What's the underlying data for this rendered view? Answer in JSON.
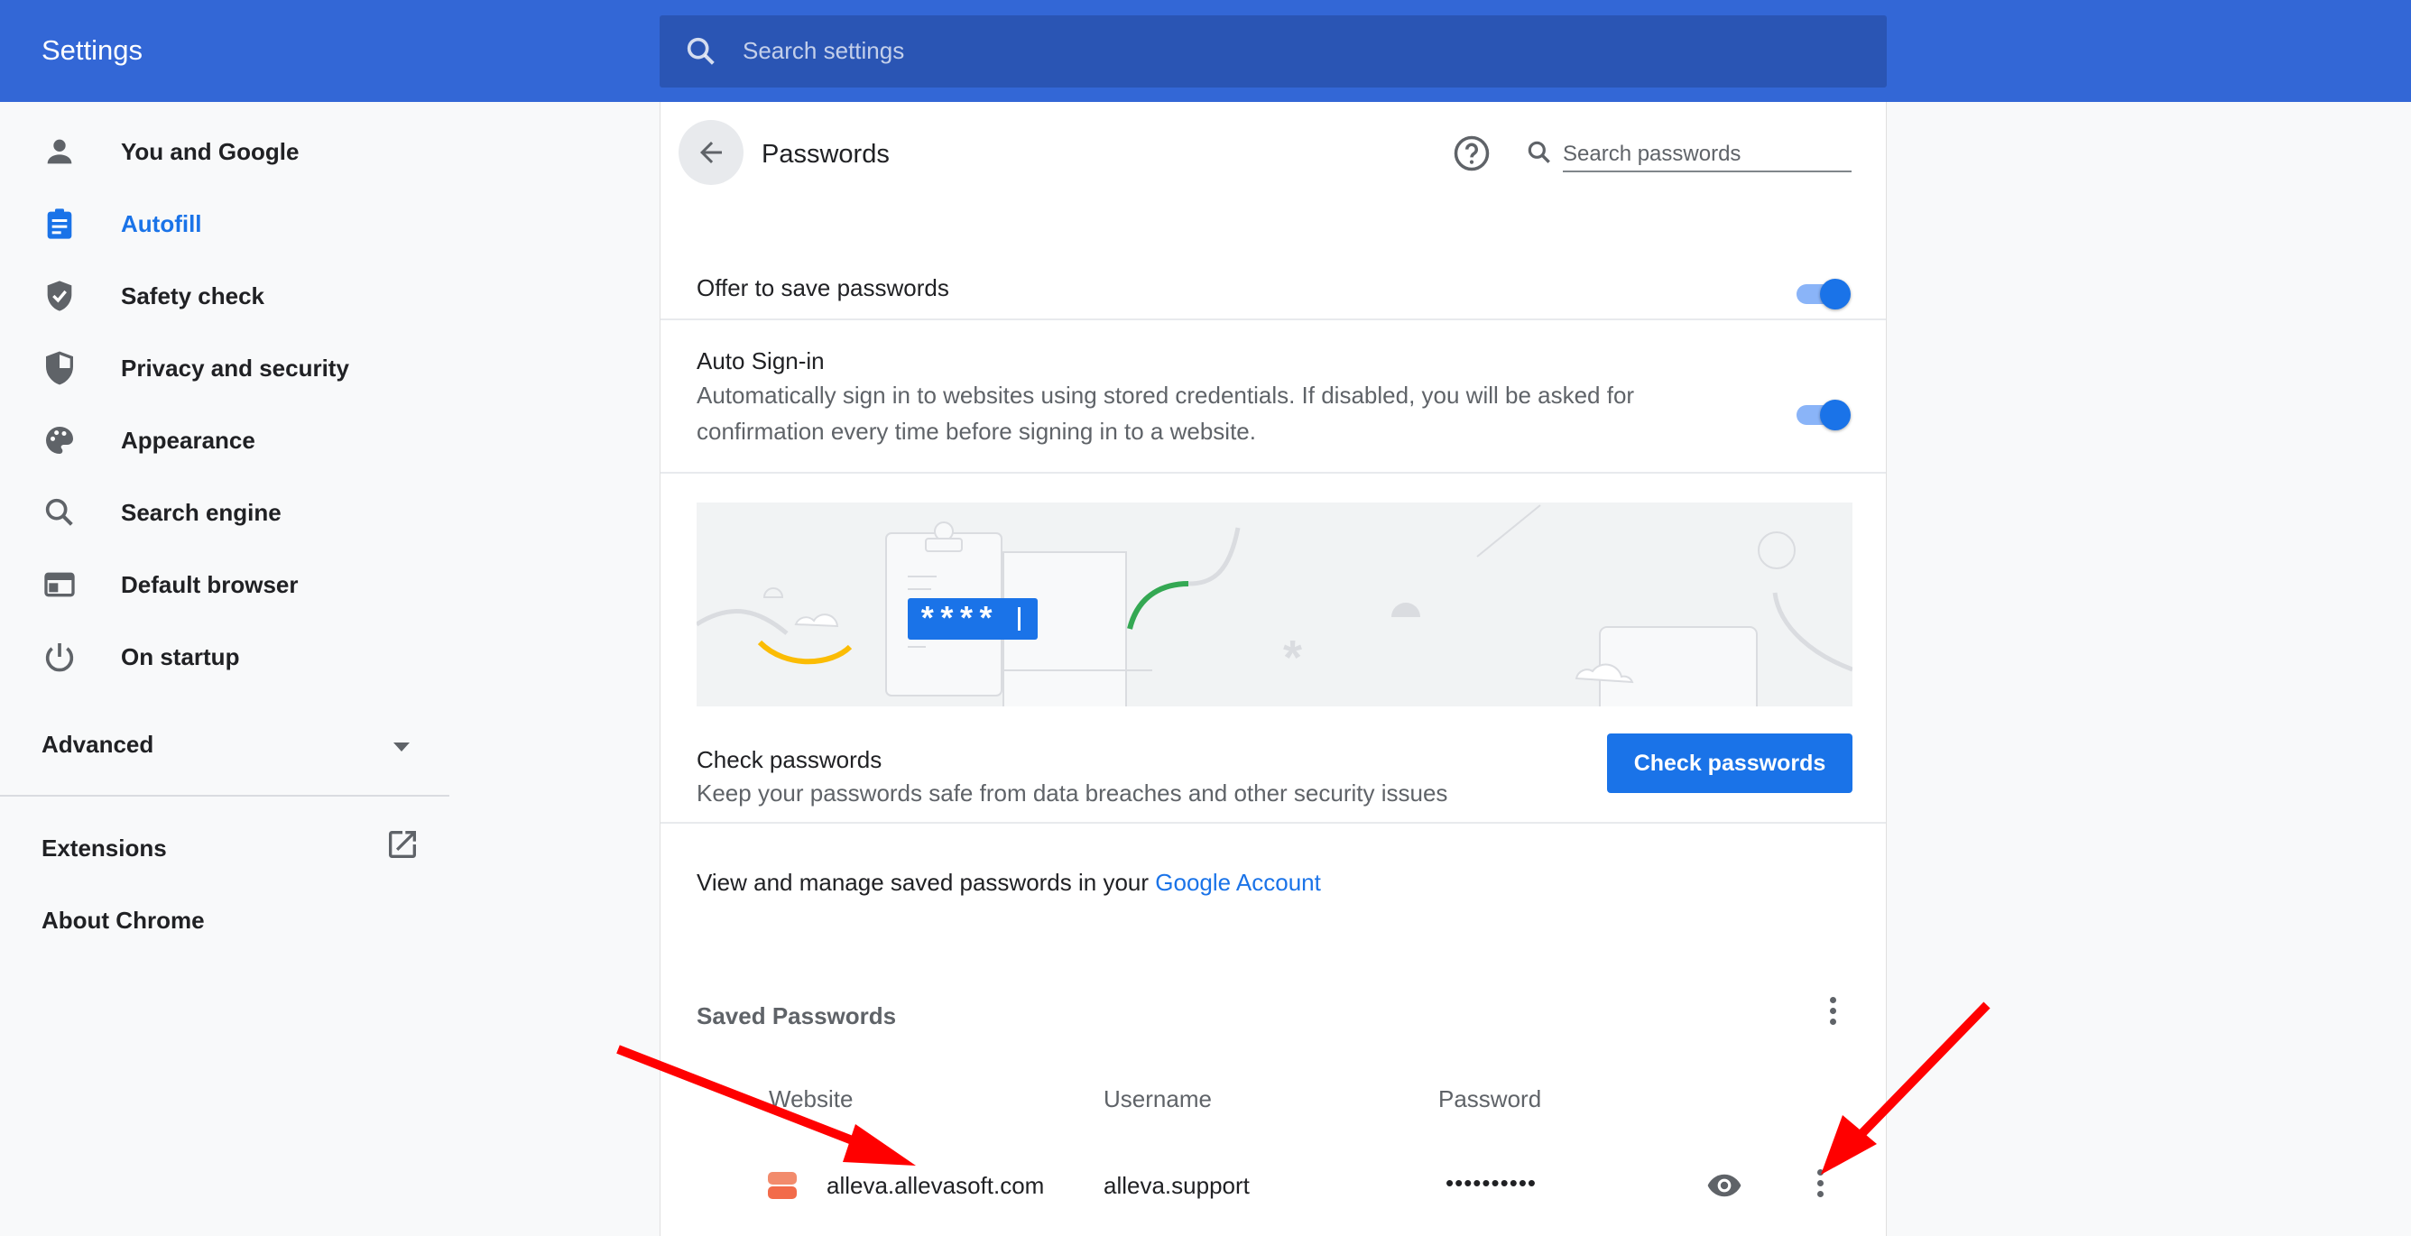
{
  "header": {
    "title": "Settings",
    "search_placeholder": "Search settings"
  },
  "sidebar": {
    "items": [
      {
        "label": "You and Google",
        "icon": "person-icon",
        "active": false
      },
      {
        "label": "Autofill",
        "icon": "clipboard-icon",
        "active": true
      },
      {
        "label": "Safety check",
        "icon": "shield-check-icon",
        "active": false
      },
      {
        "label": "Privacy and security",
        "icon": "shield-half-icon",
        "active": false
      },
      {
        "label": "Appearance",
        "icon": "palette-icon",
        "active": false
      },
      {
        "label": "Search engine",
        "icon": "search-icon",
        "active": false
      },
      {
        "label": "Default browser",
        "icon": "browser-window-icon",
        "active": false
      },
      {
        "label": "On startup",
        "icon": "power-icon",
        "active": false
      }
    ],
    "advanced_label": "Advanced",
    "extensions_label": "Extensions",
    "about_label": "About Chrome"
  },
  "passwords": {
    "title": "Passwords",
    "search_placeholder": "Search passwords",
    "offer_to_save": {
      "label": "Offer to save passwords",
      "enabled": true
    },
    "auto_signin": {
      "label": "Auto Sign-in",
      "description_line1": "Automatically sign in to websites using stored credentials. If disabled, you will be asked for",
      "description_line2": "confirmation every time before signing in to a website.",
      "enabled": true
    },
    "illustration_text": "****",
    "check": {
      "title": "Check passwords",
      "description": "Keep your passwords safe from data breaches and other security issues",
      "button_label": "Check passwords"
    },
    "manage_text": "View and manage saved passwords in your",
    "manage_link": "Google Account",
    "saved_title": "Saved Passwords",
    "columns": [
      "Website",
      "Username",
      "Password"
    ],
    "entries": [
      {
        "website": "alleva.allevasoft.com",
        "username": "alleva.support",
        "password": "••••••••••"
      }
    ]
  },
  "colors": {
    "header_blue": "#3367d6",
    "accent": "#1a73e8",
    "annotation_arrow": "#ff0000"
  }
}
